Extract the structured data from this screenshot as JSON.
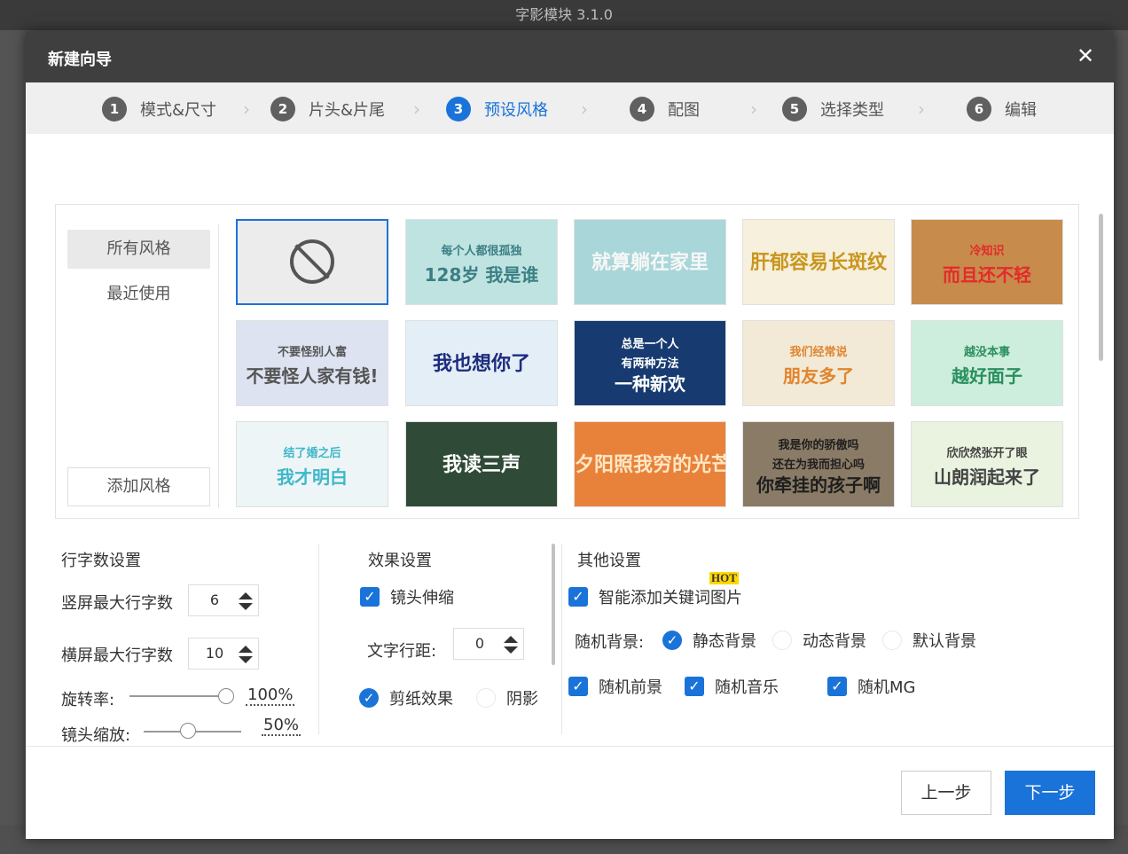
{
  "app": {
    "title": "字影模块 3.1.0"
  },
  "dialog": {
    "title": "新建向导",
    "close_symbol": "✕"
  },
  "steps": [
    {
      "num": "1",
      "label": "模式&尺寸"
    },
    {
      "num": "2",
      "label": "片头&片尾"
    },
    {
      "num": "3",
      "label": "预设风格",
      "active": true
    },
    {
      "num": "4",
      "label": "配图"
    },
    {
      "num": "5",
      "label": "选择类型"
    },
    {
      "num": "6",
      "label": "编辑"
    }
  ],
  "styles": {
    "categories": [
      {
        "label": "所有风格",
        "selected": true
      },
      {
        "label": "最近使用"
      }
    ],
    "add_button": "添加风格",
    "thumbnails": [
      {
        "id": "none",
        "lines": []
      },
      {
        "id": "t2",
        "lines": [
          "每个人都很孤独",
          "128岁 我是谁"
        ],
        "bg": "#bfe3e1",
        "fg": "#3b7f84"
      },
      {
        "id": "t3",
        "lines": [
          "就算躺在家里"
        ],
        "bg": "#a9d6d8",
        "fg": "#f7f7f7"
      },
      {
        "id": "t4",
        "lines": [
          "肝郁容易长斑纹"
        ],
        "bg": "#f6f0dc",
        "fg": "#c9961e"
      },
      {
        "id": "t5",
        "lines": [
          "冷知识",
          "而且还不轻"
        ],
        "bg": "#c78b4b",
        "fg": "#e32b2b"
      },
      {
        "id": "t6",
        "lines": [
          "不要怪别人富",
          "不要怪人家有钱!"
        ],
        "bg": "#dde3f0",
        "fg": "#555555"
      },
      {
        "id": "t7",
        "lines": [
          "我也想你了"
        ],
        "bg": "#e3eef7",
        "fg": "#1d2c7d"
      },
      {
        "id": "t8",
        "lines": [
          "总是一个人",
          "有两种方法",
          "一种新欢"
        ],
        "bg": "#173b70",
        "fg": "#ffffff"
      },
      {
        "id": "t9",
        "lines": [
          "我们经常说",
          "朋友多了"
        ],
        "bg": "#f2ead6",
        "fg": "#e0852f"
      },
      {
        "id": "t10",
        "lines": [
          "越没本事",
          "越好面子"
        ],
        "bg": "#cdeedd",
        "fg": "#2a8f5e"
      },
      {
        "id": "t11",
        "lines": [
          "结了婚之后",
          "我才明白"
        ],
        "bg": "#eef5f7",
        "fg": "#3fb8c9"
      },
      {
        "id": "t12",
        "lines": [
          "我读三声"
        ],
        "bg": "#2f4a36",
        "fg": "#ffffff"
      },
      {
        "id": "t13",
        "lines": [
          "夕阳照我穷的光芒"
        ],
        "bg": "#e8823b",
        "fg": "#ffe7c4"
      },
      {
        "id": "t14",
        "lines": [
          "我是你的骄傲吗",
          "还在为我而担心吗",
          "你牵挂的孩子啊"
        ],
        "bg": "#8a7b66",
        "fg": "#1e1e1e"
      },
      {
        "id": "t15",
        "lines": [
          "欣欣然张开了眼",
          "山朗润起来了"
        ],
        "bg": "#e9f3df",
        "fg": "#444444"
      }
    ]
  },
  "text_settings": {
    "title": "行字数设置",
    "portrait_label": "竖屏最大行字数",
    "portrait_value": "6",
    "landscape_label": "横屏最大行字数",
    "landscape_value": "10",
    "rotation_label": "旋转率:",
    "rotation_value": "100%",
    "rotation_level": 1.0,
    "zoom_label": "镜头缩放:",
    "zoom_value": "50%",
    "zoom_level": 0.5
  },
  "effect_settings": {
    "title": "效果设置",
    "lens_stretch": "镜头伸缩",
    "line_spacing_label": "文字行距:",
    "line_spacing_value": "0",
    "paper_cut": "剪纸效果",
    "shadow": "阴影"
  },
  "other_settings": {
    "title": "其他设置",
    "smart_keyword": "智能添加关键词图片",
    "hot_badge": "HOT",
    "random_bg_label": "随机背景:",
    "bg_static": "静态背景",
    "bg_dynamic": "动态背景",
    "bg_default": "默认背景",
    "random_foreground": "随机前景",
    "random_music": "随机音乐",
    "random_mg": "随机MG"
  },
  "footer": {
    "prev": "上一步",
    "next": "下一步"
  },
  "colors": {
    "accent": "#1a73d9",
    "header": "#3f3f3f"
  }
}
